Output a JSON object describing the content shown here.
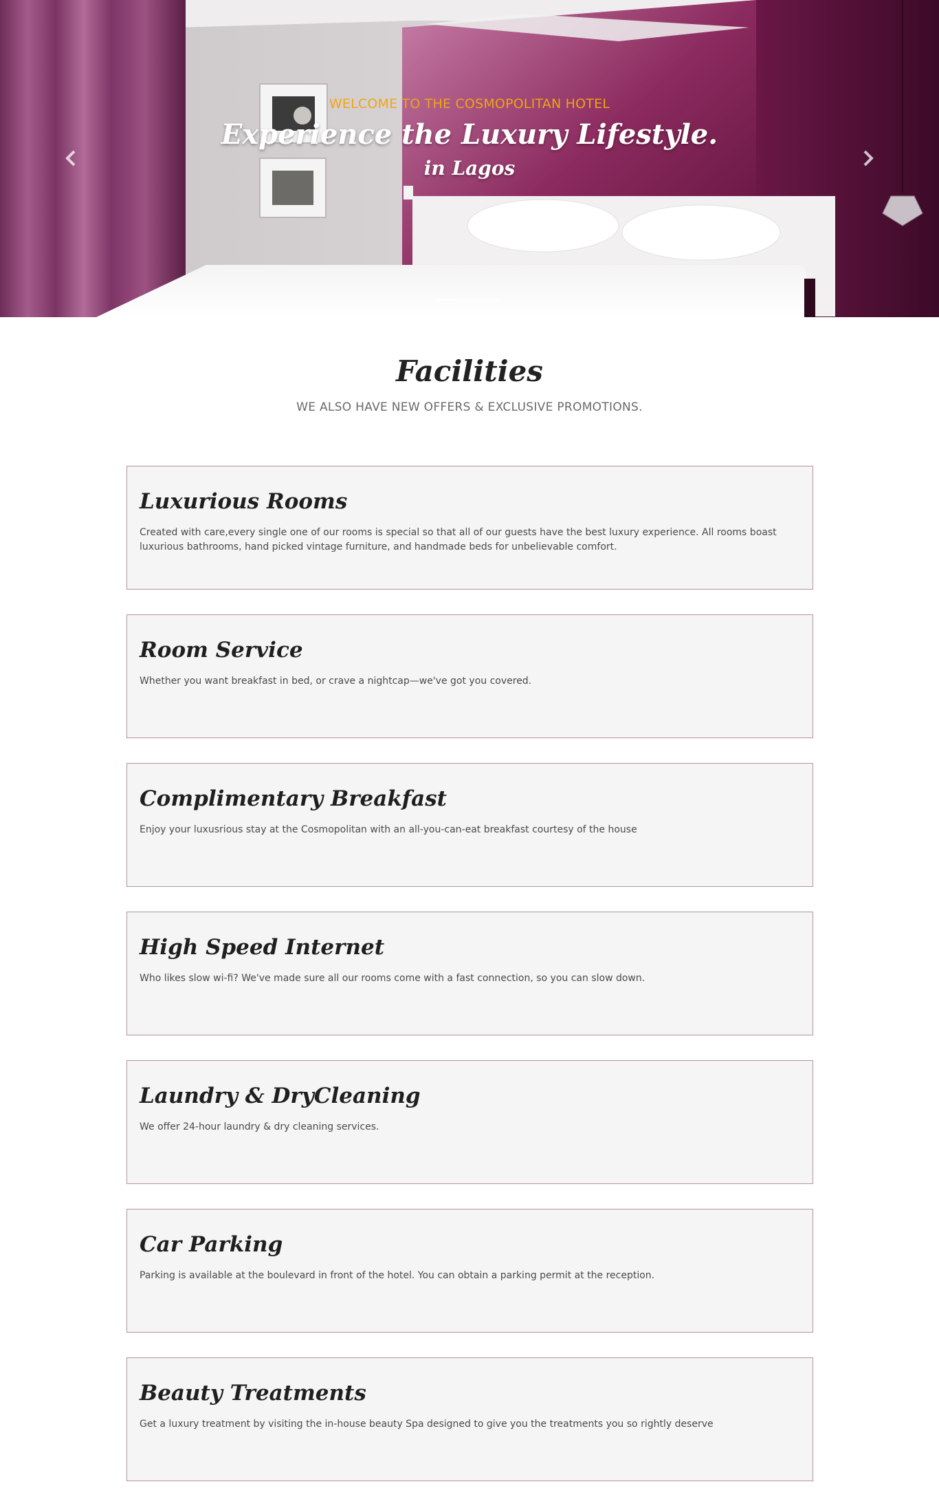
{
  "hero": {
    "kicker": "WELCOME TO THE COSMOPOLITAN HOTEL",
    "title": "Experience the Luxury Lifestyle.",
    "subtitle": "in Lagos",
    "prev_icon": "chevron-left-icon",
    "next_icon": "chevron-right-icon",
    "slide_count": 3,
    "active_slide": 1,
    "colors": {
      "kicker": "#f0a514",
      "wall": "#7a1d4f",
      "curtain": "#8a3c6e"
    }
  },
  "facilities": {
    "title": "Facilities",
    "subtitle": "WE ALSO HAVE NEW OFFERS & EXCLUSIVE PROMOTIONS.",
    "items": [
      {
        "title": "Luxurious Rooms",
        "text": "Created with care,every single one of our rooms is special so that all of our guests have the best luxury experience. All rooms boast luxurious bathrooms, hand picked vintage furniture, and handmade beds for unbelievable comfort."
      },
      {
        "title": "Room Service",
        "text": "Whether you want breakfast in bed, or crave a nightcap—we've got you covered."
      },
      {
        "title": "Complimentary Breakfast",
        "text": "Enjoy your luxusrious stay at the Cosmopolitan with an all-you-can-eat breakfast courtesy of the house"
      },
      {
        "title": "High Speed Internet",
        "text": "Who likes slow wi-fi? We've made sure all our rooms come with a fast connection, so you can slow down."
      },
      {
        "title": "Laundry & DryCleaning",
        "text": "We offer 24-hour laundry & dry cleaning services."
      },
      {
        "title": "Car Parking",
        "text": "Parking is available at the boulevard in front of the hotel. You can obtain a parking permit at the reception."
      },
      {
        "title": "Beauty Treatments",
        "text": "Get a luxury treatment by visiting the in-house beauty Spa designed to give you the treatments you so rightly deserve"
      }
    ]
  }
}
